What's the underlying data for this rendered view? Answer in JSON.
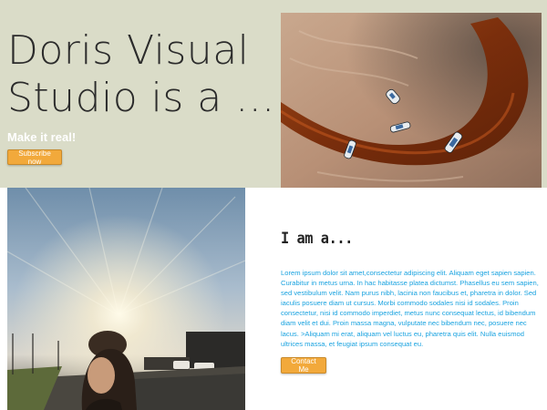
{
  "colors": {
    "hero_background": "#dadcc8",
    "accent_button": "#f2a93b",
    "body_text": "#1aa3e0",
    "heading_text": "#222222"
  },
  "hero": {
    "title": "Doris Visual\nStudio is a ...",
    "tagline": "Make it real!",
    "subscribe_label": "Subscribe now",
    "image_icon": "aerial-shore-boats-photo"
  },
  "about": {
    "heading": "I am a...",
    "body": "Lorem ipsum dolor sit amet,consectetur adipiscing elit. Aliquam eget sapien sapien. Curabitur in metus urna. In hac habitasse platea dictumst. Phasellus eu sem sapien, sed vestibulum velit. Nam purus nibh, lacinia non faucibus et, pharetra in dolor. Sed iaculis posuere diam ut cursus. Morbi commodo sodales nisi id sodales. Proin consectetur, nisi id commodo imperdiet, metus nunc consequat lectus, id bibendum diam velit et dui. Proin massa magna, vulputate nec bibendum nec, posuere nec lacus. >Aliquam mi erat, aliquam vel luctus eu, pharetra quis elit. Nulla euismod ultrices massa, et feugiat ipsum consequat eu.",
    "contact_label": "Contact Me",
    "image_icon": "portrait-sunset-street-photo"
  }
}
